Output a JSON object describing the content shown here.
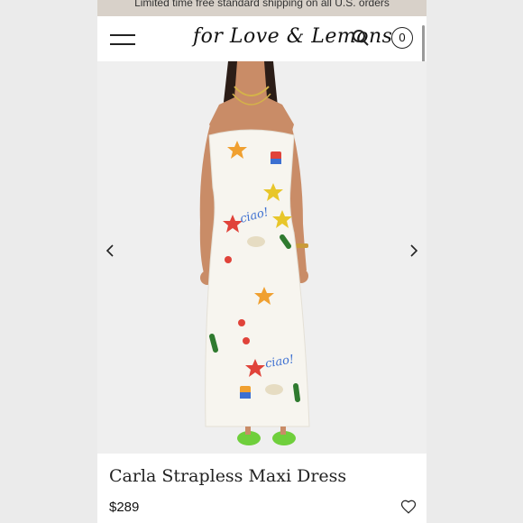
{
  "promo": {
    "text": "Limited time free standard shipping on all U.S. orders"
  },
  "header": {
    "logo": "for Love & Lemons",
    "cart_count": "0"
  },
  "icons": {
    "menu": "hamburger-menu-icon",
    "search": "search-icon",
    "cart": "cart-icon",
    "prev": "chevron-left-icon",
    "next": "chevron-right-icon",
    "wishlist": "heart-icon"
  },
  "hero_text": {
    "ciao": "ciao!"
  },
  "product": {
    "name": "Carla Strapless Maxi Dress",
    "price": "$289"
  },
  "colors": {
    "promo_bg": "#d8d1c9",
    "dress": "#f7f5ef",
    "skin": "#c98c67",
    "shoes": "#6fcf3c"
  }
}
